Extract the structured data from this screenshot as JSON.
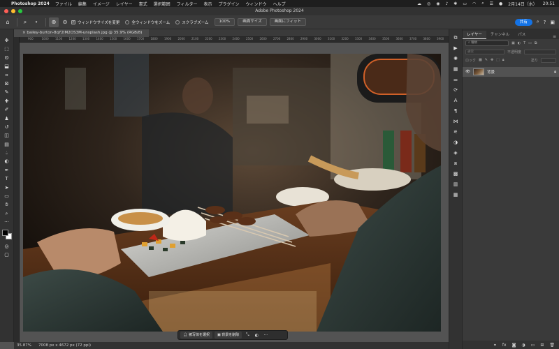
{
  "menubar": {
    "app_name": "Photoshop 2024",
    "menus": [
      "ファイル",
      "編集",
      "イメージ",
      "レイヤー",
      "書式",
      "選択範囲",
      "フィルター",
      "表示",
      "プラグイン",
      "ウィンドウ",
      "ヘルプ"
    ],
    "date": "2月14日（水）",
    "time": "20:51"
  },
  "window": {
    "title": "Adobe Photoshop 2024"
  },
  "options_bar": {
    "resize_window_label": "ウィンドウサイズを変更",
    "all_windows_label": "全ウィンドウをズーム",
    "scrubby_zoom_label": "スクラブズーム",
    "zoom_value": "100%",
    "fit_screen_label": "画面サイズ",
    "fill_screen_label": "画面にフィット",
    "share_label": "共有"
  },
  "document": {
    "tab_title": "bailey-burton-8qY2IM2OS3M-unsplash.jpg @ 35.9% (RGB/8)",
    "ruler_ticks": [
      "900",
      "1000",
      "1100",
      "1200",
      "1300",
      "1400",
      "1500",
      "1600",
      "1700",
      "1800",
      "1900",
      "2000",
      "2100",
      "2200",
      "2300",
      "2400",
      "2500",
      "2600",
      "2700",
      "2800",
      "2900",
      "3000",
      "3100",
      "3200",
      "3300",
      "3400",
      "3500",
      "3600",
      "3700",
      "3800",
      "3900"
    ]
  },
  "context_bar": {
    "select_subject_label": "被写体を選択",
    "remove_bg_label": "背景を削除"
  },
  "status": {
    "zoom": "35.87%",
    "doc_info": "7008 px x 4672 px (72 ppi)"
  },
  "layers_panel": {
    "tabs": [
      "レイヤー",
      "チャンネル",
      "パス"
    ],
    "search_placeholder": "種類",
    "blend_mode": "通常",
    "opacity_label": "不透明度",
    "lock_label": "ロック",
    "fill_label": "塗り",
    "layer_name": "背景"
  },
  "colors": {
    "accent": "#1473e6",
    "close_dot": "#ff5f57",
    "min_dot": "#febc2e",
    "max_dot": "#28c840"
  }
}
